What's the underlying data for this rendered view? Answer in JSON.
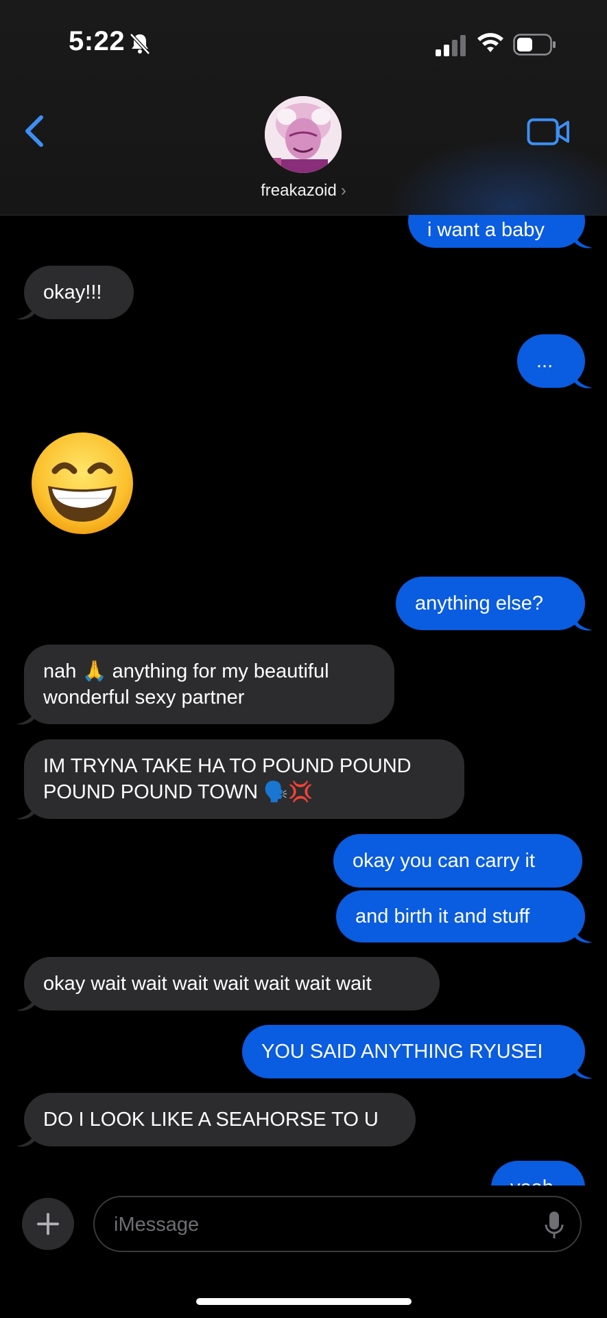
{
  "status_bar": {
    "time": "5:22",
    "icons": [
      "bell-slash-icon",
      "cellular-signal-icon",
      "wifi-icon",
      "battery-icon"
    ]
  },
  "header": {
    "contact_name": "freakazoid",
    "chevron": "›",
    "icons": [
      "back-chevron-icon",
      "avatar",
      "video-call-icon"
    ],
    "accent_color": "#3d8ff5"
  },
  "messages": [
    {
      "from": "me",
      "text": "i want a baby"
    },
    {
      "from": "them",
      "text": "okay!!!"
    },
    {
      "from": "me",
      "text": "..."
    },
    {
      "from": "them",
      "emoji": "grinning-face-with-smiling-eyes"
    },
    {
      "from": "me",
      "text": "anything else?"
    },
    {
      "from": "them",
      "text": "nah 🙏 anything for my beautiful wonderful sexy partner"
    },
    {
      "from": "them",
      "text": "IM TRYNA TAKE HA TO POUND POUND POUND POUND TOWN 🗣️💢"
    },
    {
      "from": "me",
      "text": "okay you can carry it"
    },
    {
      "from": "me",
      "text": "and birth it and stuff"
    },
    {
      "from": "them",
      "text": "okay wait wait wait wait wait wait wait"
    },
    {
      "from": "me",
      "text": "YOU SAID ANYTHING RYUSEI"
    },
    {
      "from": "them",
      "text": "DO I LOOK LIKE A SEAHORSE TO U"
    },
    {
      "from": "me",
      "text": "yeah"
    }
  ],
  "composer": {
    "placeholder": "iMessage",
    "icons": [
      "plus-icon",
      "microphone-icon"
    ]
  },
  "colors": {
    "incoming_bubble": "#2c2c2e",
    "outgoing_bubble": "#0a5ce0",
    "background": "#000000"
  }
}
